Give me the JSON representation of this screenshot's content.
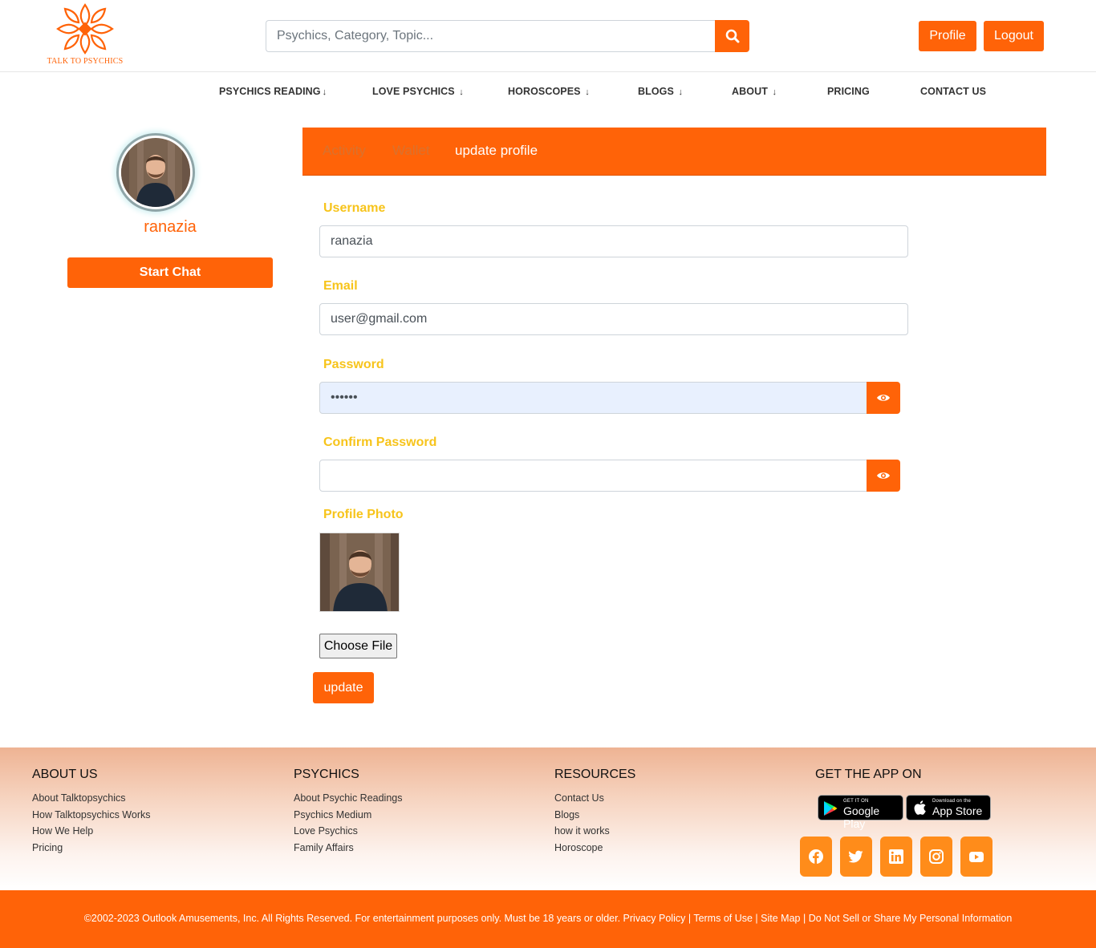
{
  "brand": {
    "logo_text": "TALK TO PSYCHICS",
    "accent": "#ff6308",
    "label_color": "#f7c41b"
  },
  "search": {
    "placeholder": "Psychics, Category, Topic..."
  },
  "header": {
    "profile_label": "Profile",
    "logout_label": "Logout"
  },
  "nav": {
    "items": [
      {
        "label": "PSYCHICS READING",
        "arrow": "↓"
      },
      {
        "label": "LOVE PSYCHICS",
        "arrow": "↓"
      },
      {
        "label": "HOROSCOPES",
        "arrow": "↓"
      },
      {
        "label": "BLOGS",
        "arrow": "↓"
      },
      {
        "label": "ABOUT",
        "arrow": "↓"
      },
      {
        "label": "PRICING",
        "arrow": ""
      },
      {
        "label": "CONTACT US",
        "arrow": ""
      }
    ]
  },
  "profile_card": {
    "username": "ranazia",
    "start_chat_label": "Start Chat"
  },
  "tabs": [
    {
      "label": "Activity",
      "active": false
    },
    {
      "label": "Wallet",
      "active": false
    },
    {
      "label": "update profile",
      "active": true
    }
  ],
  "form": {
    "username_label": "Username",
    "username_value": "ranazia",
    "email_label": "Email",
    "email_value": "user@gmail.com",
    "password_label": "Password",
    "password_value": "••••••",
    "confirm_label": "Confirm Password",
    "confirm_value": "",
    "photo_label": "Profile Photo",
    "choose_file_label": "Choose File",
    "update_label": "update"
  },
  "footer": {
    "columns": [
      {
        "heading": "ABOUT US",
        "links": [
          "About Talktopsychics",
          "How Talktopsychics Works",
          "How We Help",
          "Pricing"
        ]
      },
      {
        "heading": "PSYCHICS",
        "links": [
          "About Psychic Readings",
          "Psychics Medium",
          "Love Psychics",
          "Family Affairs"
        ]
      },
      {
        "heading": "RESOURCES",
        "links": [
          "Contact Us",
          "Blogs",
          "how it works",
          "Horoscope"
        ]
      }
    ],
    "app_heading": "GET THE APP ON",
    "google_play": {
      "small": "GET IT ON",
      "big": "Google Play"
    },
    "app_store": {
      "small": "Download on the",
      "big": "App Store"
    },
    "social_icons": [
      "facebook-icon",
      "twitter-icon",
      "linkedin-icon",
      "instagram-icon",
      "youtube-icon"
    ],
    "social_color": "#ff8c1a"
  },
  "bottom_bar": {
    "copyright": "©2002-2023 Outlook Amusements, Inc. All Rights Reserved. For entertainment purposes only. Must be 18 years or older.",
    "privacy": "Privacy Policy",
    "terms": "Terms of Use",
    "sitemap": "Site Map",
    "donotsell": "Do Not Sell or Share My Personal Information",
    "separator": " | "
  }
}
